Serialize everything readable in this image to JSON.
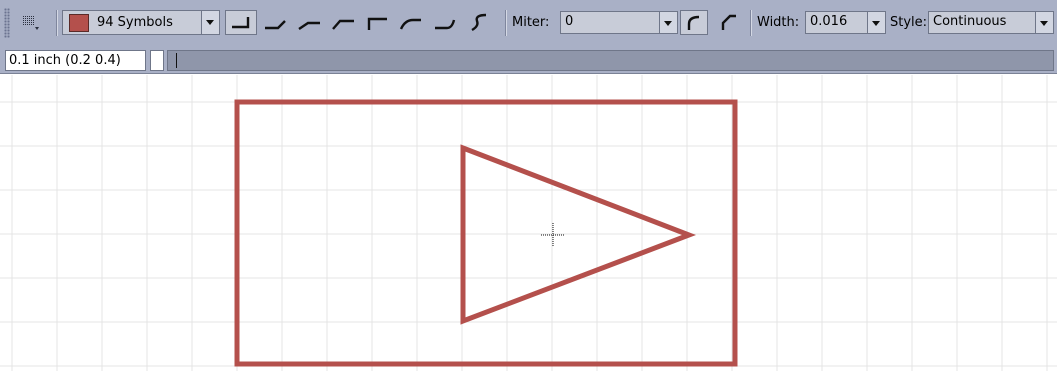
{
  "toolbar": {
    "layer": {
      "label": "94 Symbols",
      "color": "#b4504c"
    },
    "miter": {
      "label": "Miter:",
      "value": "0"
    },
    "width": {
      "label": "Width:",
      "value": "0.016"
    },
    "style": {
      "label": "Style:",
      "value": "Continuous"
    },
    "wire_bend_icons": [
      "bend-0-icon",
      "bend-1-icon",
      "bend-2-icon",
      "bend-3-icon",
      "bend-4-icon",
      "bend-5-icon",
      "bend-6-icon",
      "bend-7-icon"
    ],
    "miter_icons": [
      "round-miter-icon",
      "straight-miter-icon"
    ]
  },
  "cmdbar": {
    "coordinate": "0.1 inch (0.2 0.4)",
    "command": ""
  },
  "colors": {
    "toolbar_bg": "#a9b0c6",
    "wire": "#b4504c",
    "grid": "#e4e4e4"
  }
}
